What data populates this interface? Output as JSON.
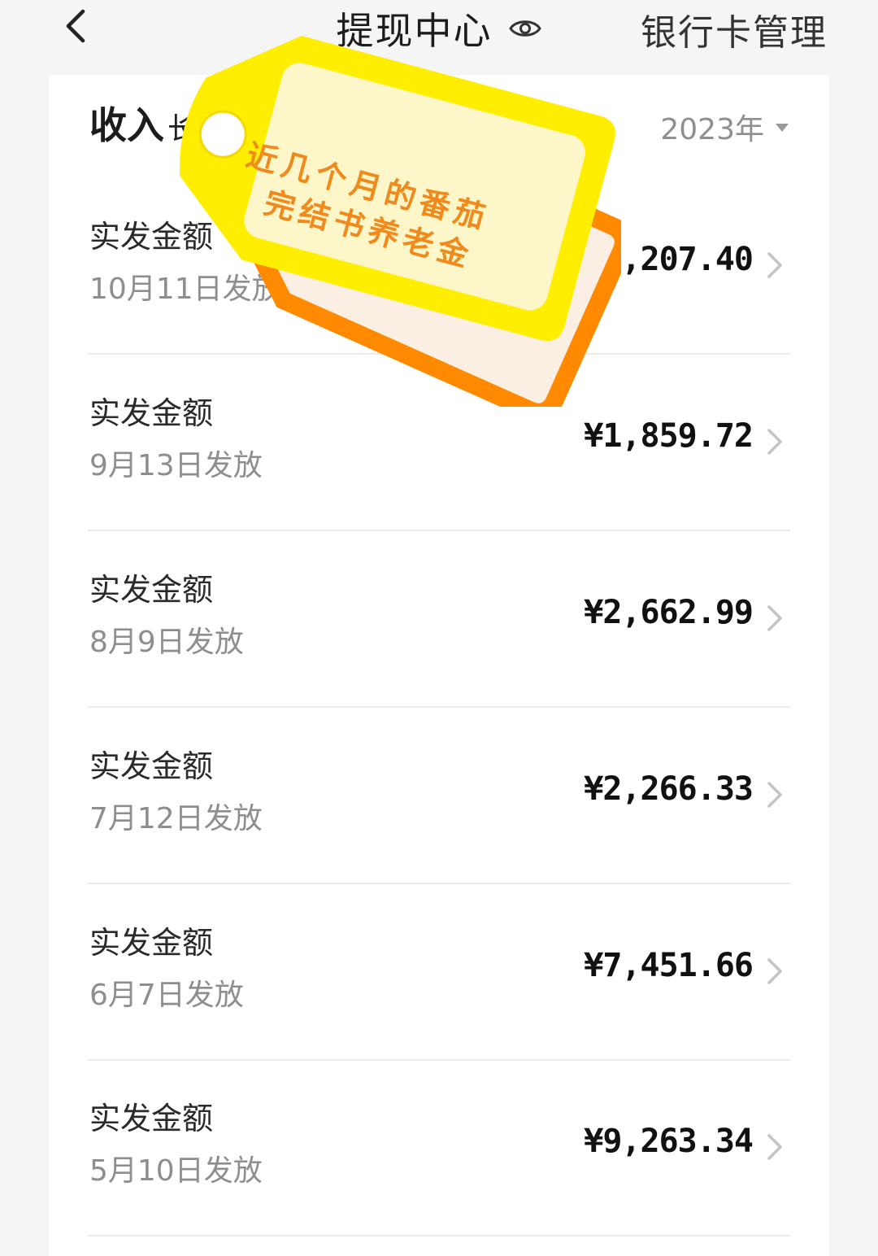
{
  "header": {
    "title": "提现中心",
    "bank_card_label": "银行卡管理"
  },
  "card": {
    "title": "收入",
    "partial_tab": "长旱",
    "year": "2023年"
  },
  "rows": [
    {
      "label": "实发金额",
      "date": "10月11日发放",
      "amount": "¥1,207.40"
    },
    {
      "label": "实发金额",
      "date": "9月13日发放",
      "amount": "¥1,859.72"
    },
    {
      "label": "实发金额",
      "date": "8月9日发放",
      "amount": "¥2,662.99"
    },
    {
      "label": "实发金额",
      "date": "7月12日发放",
      "amount": "¥2,266.33"
    },
    {
      "label": "实发金额",
      "date": "6月7日发放",
      "amount": "¥7,451.66"
    },
    {
      "label": "实发金额",
      "date": "5月10日发放",
      "amount": "¥9,263.34"
    }
  ],
  "sticker": {
    "line1": "近几个月的番茄",
    "line2": "完结书养老金",
    "colors": {
      "tag_fill": "#ffee00",
      "tag_back": "#ff8a00",
      "label_bg": "#fdf6c8",
      "text": "#f08a1c"
    }
  }
}
